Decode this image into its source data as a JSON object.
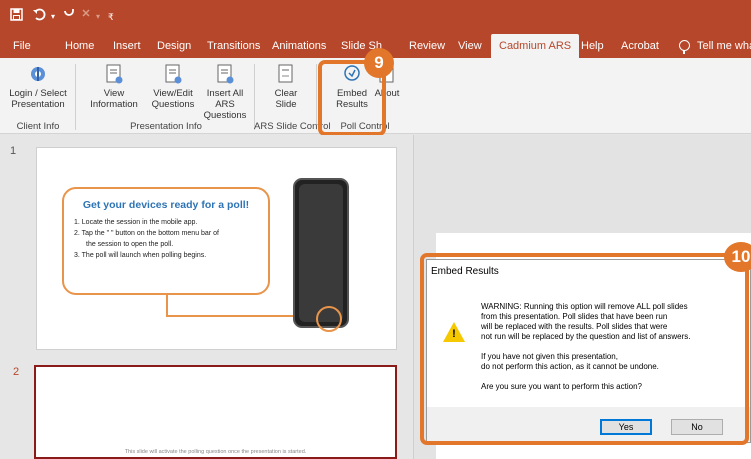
{
  "quick_access": {
    "save_icon": "save-icon",
    "undo_icon": "undo-icon",
    "redo_icon": "redo-icon",
    "customize_icon": "customize-icon"
  },
  "tabs": [
    {
      "label": "File"
    },
    {
      "label": "Home"
    },
    {
      "label": "Insert"
    },
    {
      "label": "Design"
    },
    {
      "label": "Transitions"
    },
    {
      "label": "Animations"
    },
    {
      "label": "Slide Sh"
    },
    {
      "label": "Review"
    },
    {
      "label": "View"
    },
    {
      "label": "Cadmium ARS"
    },
    {
      "label": "Help"
    },
    {
      "label": "Acrobat"
    },
    {
      "label": "Tell me what"
    }
  ],
  "ribbon": {
    "login": "Login / Select Presentation",
    "view_info": "View Information",
    "view_edit": "View/Edit Questions",
    "insert_all": "Insert All ARS Questions",
    "clear_slide": "Clear Slide",
    "embed": "Embed Results",
    "about": "About",
    "groups": {
      "client_info": "Client Info",
      "presentation_info": "Presentation Info",
      "ars_slide_control": "ARS Slide Control",
      "poll_control": "Poll Control"
    }
  },
  "callouts": {
    "nine": "9",
    "ten": "10"
  },
  "slides": {
    "one_number": "1",
    "two_number": "2",
    "poll_title": "Get your devices ready for a poll!",
    "steps": [
      "1.  Locate the session in the mobile app.",
      "2.  Tap the \"  \" button on the bottom menu bar of",
      "the session to open the poll.",
      "3.  The poll will launch when polling begins."
    ],
    "slide2_text": "This slide will activate the polling question once the presentation is started."
  },
  "dialog": {
    "title": "Embed Results",
    "lines": [
      "WARNING: Running this option will remove ALL poll slides",
      "from this presentation. Poll slides that have been run",
      "will be replaced with the results. Poll slides that were",
      "not run will be replaced by the question and list of answers.",
      "If you have not given this presentation,",
      "do not perform this action, as it cannot be undone.",
      "Are you sure you want to perform this action?"
    ],
    "yes": "Yes",
    "no": "No"
  },
  "colors": {
    "accent": "#b7472a",
    "callout": "#e2772b",
    "link_blue": "#2e74b5"
  }
}
